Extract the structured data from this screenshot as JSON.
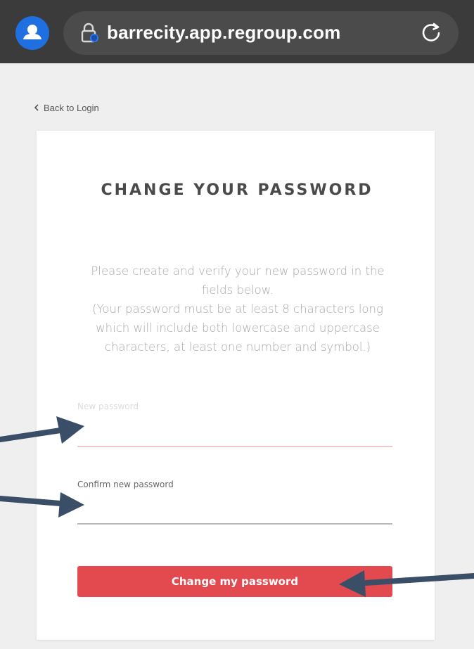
{
  "browser": {
    "url": "barrecity.app.regroup.com"
  },
  "page": {
    "back_link": "Back to Login",
    "title": "CHANGE YOUR PASSWORD",
    "instructions": [
      "Please create and verify your new password in the",
      "fields below.",
      "(Your password must be at least 8 characters long",
      "which will include both lowercase and uppercase",
      "characters, at least one number and symbol.)"
    ],
    "new_password_placeholder": "New password",
    "new_password_value": "",
    "confirm_password_label": "Confirm new password",
    "confirm_password_value": "",
    "submit_label": "Change my password"
  },
  "colors": {
    "accent": "#e24a4f",
    "browser_bar": "#3b3b3b",
    "avatar": "#1f6fe0",
    "annotation_arrow": "#3b4e68"
  },
  "icons": [
    "account-icon",
    "lock-icon",
    "reload-icon",
    "chevron-left-icon"
  ]
}
